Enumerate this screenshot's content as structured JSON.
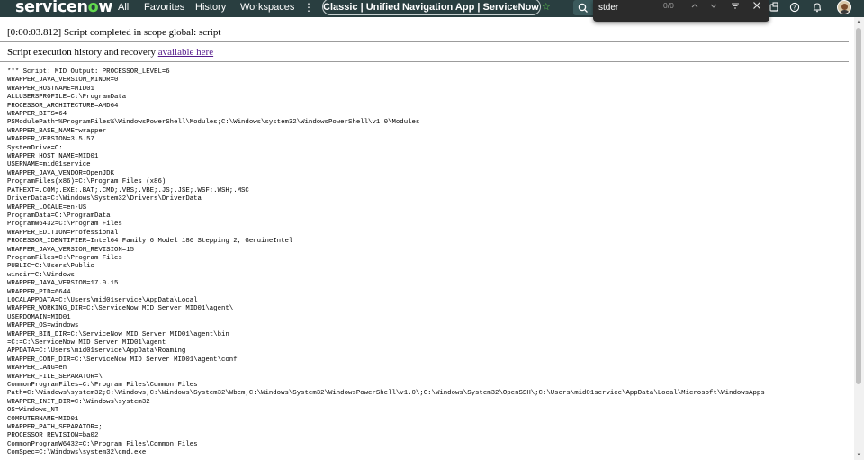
{
  "nav": {
    "logo_text_pre": "servicen",
    "logo_text_o": "o",
    "logo_text_post": "w",
    "items": [
      "All",
      "Favorites",
      "History",
      "Workspaces"
    ],
    "kebab": "⋮",
    "context_title": "Classic | Unified Navigation App | ServiceNow",
    "context_star": "☆",
    "icons": [
      "search-icon",
      "bell-icon",
      "help-icon",
      "notification-icon",
      "avatar"
    ]
  },
  "findbar": {
    "query": "stder",
    "count": "0/0",
    "icons": [
      "chevron-up-icon",
      "chevron-down-icon",
      "options-icon",
      "close-icon"
    ]
  },
  "content": {
    "status": "[0:00:03.812] Script completed in scope global: script",
    "history_prefix": "Script execution history and recovery ",
    "history_link": "available here",
    "output_lines": [
      "*** Script: MID Output: PROCESSOR_LEVEL=6",
      "WRAPPER_JAVA_VERSION_MINOR=0",
      "WRAPPER_HOSTNAME=MID01",
      "ALLUSERSPROFILE=C:\\ProgramData",
      "PROCESSOR_ARCHITECTURE=AMD64",
      "WRAPPER_BITS=64",
      "PSModulePath=%ProgramFiles%\\WindowsPowerShell\\Modules;C:\\Windows\\system32\\WindowsPowerShell\\v1.0\\Modules",
      "WRAPPER_BASE_NAME=wrapper",
      "WRAPPER_VERSION=3.5.57",
      "SystemDrive=C:",
      "WRAPPER_HOST_NAME=MID01",
      "USERNAME=mid01service",
      "WRAPPER_JAVA_VENDOR=OpenJDK",
      "ProgramFiles(x86)=C:\\Program Files (x86)",
      "PATHEXT=.COM;.EXE;.BAT;.CMD;.VBS;.VBE;.JS;.JSE;.WSF;.WSH;.MSC",
      "DriverData=C:\\Windows\\System32\\Drivers\\DriverData",
      "WRAPPER_LOCALE=en-US",
      "ProgramData=C:\\ProgramData",
      "ProgramW6432=C:\\Program Files",
      "WRAPPER_EDITION=Professional",
      "PROCESSOR_IDENTIFIER=Intel64 Family 6 Model 186 Stepping 2, GenuineIntel",
      "WRAPPER_JAVA_VERSION_REVISION=15",
      "ProgramFiles=C:\\Program Files",
      "PUBLIC=C:\\Users\\Public",
      "windir=C:\\Windows",
      "WRAPPER_JAVA_VERSION=17.0.15",
      "WRAPPER_PID=6644",
      "LOCALAPPDATA=C:\\Users\\mid01service\\AppData\\Local",
      "WRAPPER_WORKING_DIR=C:\\ServiceNow MID Server MID01\\agent\\",
      "USERDOMAIN=MID01",
      "WRAPPER_OS=windows",
      "WRAPPER_BIN_DIR=C:\\ServiceNow MID Server MID01\\agent\\bin",
      "=C:=C:\\ServiceNow MID Server MID01\\agent",
      "APPDATA=C:\\Users\\mid01service\\AppData\\Roaming",
      "WRAPPER_CONF_DIR=C:\\ServiceNow MID Server MID01\\agent\\conf",
      "WRAPPER_LANG=en",
      "WRAPPER_FILE_SEPARATOR=\\",
      "CommonProgramFiles=C:\\Program Files\\Common Files",
      "Path=C:\\Windows\\system32;C:\\Windows;C:\\Windows\\System32\\Wbem;C:\\Windows\\System32\\WindowsPowerShell\\v1.0\\;C:\\Windows\\System32\\OpenSSH\\;C:\\Users\\mid01service\\AppData\\Local\\Microsoft\\WindowsApps",
      "WRAPPER_INIT_DIR=C:\\Windows\\system32",
      "OS=Windows_NT",
      "COMPUTERNAME=MID01",
      "WRAPPER_PATH_SEPARATOR=;",
      "PROCESSOR_REVISION=ba02",
      "CommonProgramW6432=C:\\Program Files\\Common Files",
      "ComSpec=C:\\Windows\\system32\\cmd.exe"
    ]
  }
}
